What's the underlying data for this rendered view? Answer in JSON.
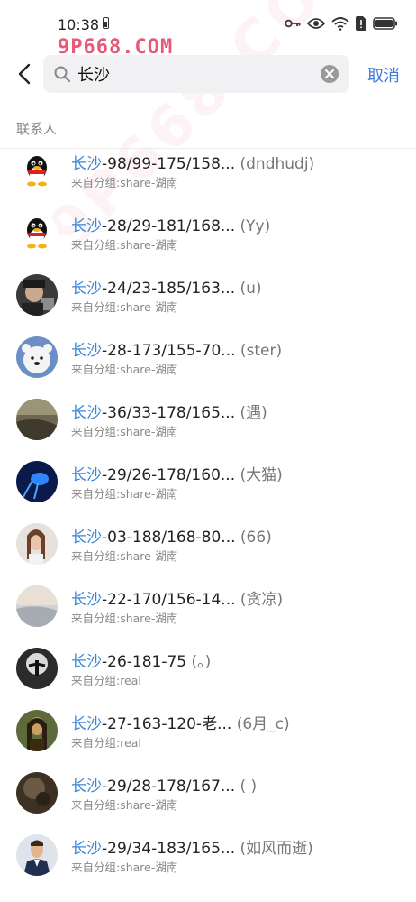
{
  "status_bar": {
    "time": "10:38"
  },
  "watermark": "9P668.COM",
  "diagonal_watermark": "9P668.COM",
  "search": {
    "query": "长沙",
    "cancel_label": "取消"
  },
  "section_label": "联系人",
  "contacts": [
    {
      "highlight": "长沙",
      "rest": "-98/99-175/158...",
      "nickname": "(dndhudj)",
      "group": "来自分组:share-湖南",
      "avatar": "qq-penguin"
    },
    {
      "highlight": "长沙",
      "rest": "-28/29-181/168...",
      "nickname": "(Yy)",
      "group": "来自分组:share-湖南",
      "avatar": "qq-penguin"
    },
    {
      "highlight": "长沙",
      "rest": "-24/23-185/163...",
      "nickname": "(u)",
      "group": "来自分组:share-湖南",
      "avatar": "photo-dark"
    },
    {
      "highlight": "长沙",
      "rest": "-28-173/155-70...",
      "nickname": "(ster)",
      "group": "来自分组:share-湖南",
      "avatar": "bear"
    },
    {
      "highlight": "长沙",
      "rest": "-36/33-178/165...",
      "nickname": "(遇)",
      "group": "来自分组:share-湖南",
      "avatar": "photo-sepia"
    },
    {
      "highlight": "长沙",
      "rest": "-29/26-178/160...",
      "nickname": "(大猫)",
      "group": "来自分组:share-湖南",
      "avatar": "photo-blue"
    },
    {
      "highlight": "长沙",
      "rest": "-03-188/168-80...",
      "nickname": "(66)",
      "group": "来自分组:share-湖南",
      "avatar": "photo-girl"
    },
    {
      "highlight": "长沙",
      "rest": "-22-170/156-14...",
      "nickname": "(贪凉)",
      "group": "来自分组:share-湖南",
      "avatar": "photo-sky"
    },
    {
      "highlight": "长沙",
      "rest": "-26-181-75",
      "nickname": "(。)",
      "group": "来自分组:real",
      "avatar": "photo-figure"
    },
    {
      "highlight": "长沙",
      "rest": "-27-163-120-老...",
      "nickname": "(6月_c)",
      "group": "来自分组:real",
      "avatar": "photo-monalisa"
    },
    {
      "highlight": "长沙",
      "rest": "-29/28-178/167...",
      "nickname": "( )",
      "group": "来自分组:share-湖南",
      "avatar": "photo-brown"
    },
    {
      "highlight": "长沙",
      "rest": "-29/34-183/165...",
      "nickname": "(如风而逝)",
      "group": "来自分组:share-湖南",
      "avatar": "photo-suit"
    }
  ],
  "colors": {
    "highlight": "#3a86d6",
    "accent": "#3e7cd8",
    "watermark": "#e65a78"
  }
}
